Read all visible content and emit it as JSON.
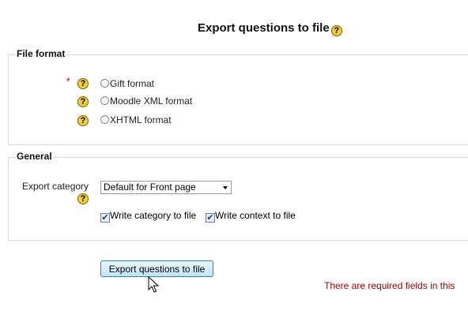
{
  "page_title": "Export questions to file",
  "help_glyph": "?",
  "file_format": {
    "legend": "File format",
    "required_marker": "*",
    "options": [
      {
        "label": "Gift format",
        "selected": false
      },
      {
        "label": "Moodle XML format",
        "selected": false
      },
      {
        "label": "XHTML format",
        "selected": false
      }
    ]
  },
  "general": {
    "legend": "General",
    "export_category_label": "Export category",
    "export_category_value": "Default for Front page",
    "write_category_label": "Write category to file",
    "write_category_checked": true,
    "write_context_label": "Write context to file",
    "write_context_checked": true
  },
  "submit_label": "Export questions to file",
  "required_notice": "There are required fields in this",
  "colors": {
    "help_icon": "#f3d03b",
    "required": "#cc0000",
    "notice": "#990000",
    "button_border": "#3c7fb1"
  }
}
